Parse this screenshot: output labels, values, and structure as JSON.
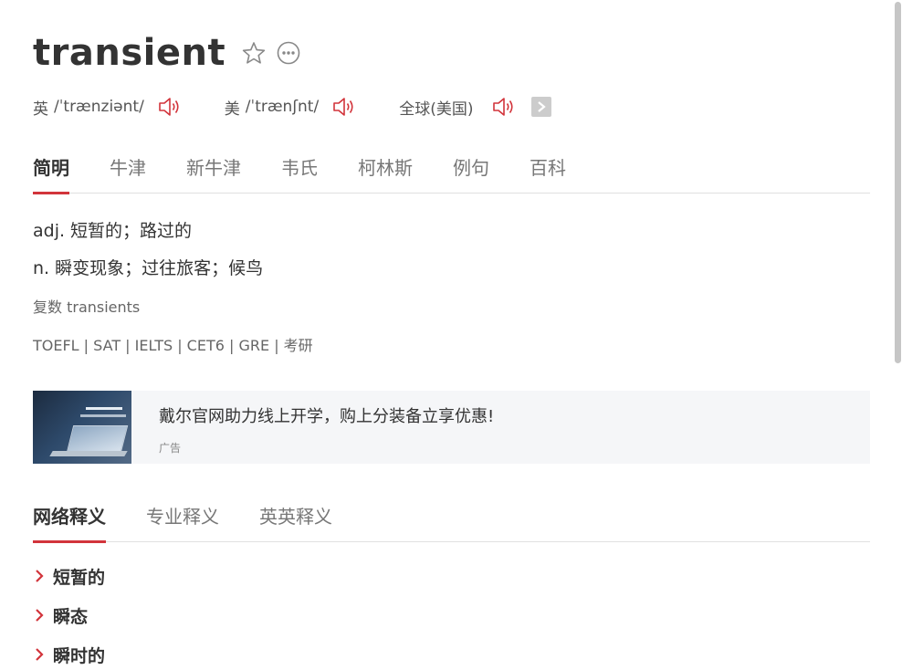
{
  "word": "transient",
  "icons": {
    "star": "star-outline-icon",
    "more": "more-dots-icon",
    "speaker": "speaker-icon",
    "arrow": "chevron-right-icon"
  },
  "colors": {
    "accent": "#d2343b",
    "text": "#333333",
    "muted": "#777777",
    "ad_bg": "#f5f6f8"
  },
  "pronunciations": [
    {
      "region": "英",
      "phonetic": "/ˈtrænziənt/"
    },
    {
      "region": "美",
      "phonetic": "/ˈtrænʃnt/"
    },
    {
      "region": "全球(美国)",
      "phonetic": ""
    }
  ],
  "tabs": [
    "简明",
    "牛津",
    "新牛津",
    "韦氏",
    "柯林斯",
    "例句",
    "百科"
  ],
  "active_tab": "简明",
  "definitions": [
    "adj. 短暂的；路过的",
    "n. 瞬变现象；过往旅客；候鸟"
  ],
  "plural": "复数 transients",
  "exams": "TOEFL | SAT | IELTS | CET6 | GRE | 考研",
  "ad": {
    "title": "戴尔官网助力线上开学，购上分装备立享优惠!",
    "tag": "广告"
  },
  "net_tabs": [
    "网络释义",
    "专业释义",
    "英英释义"
  ],
  "active_net_tab": "网络释义",
  "net_items": [
    "短暂的",
    "瞬态",
    "瞬时的"
  ]
}
